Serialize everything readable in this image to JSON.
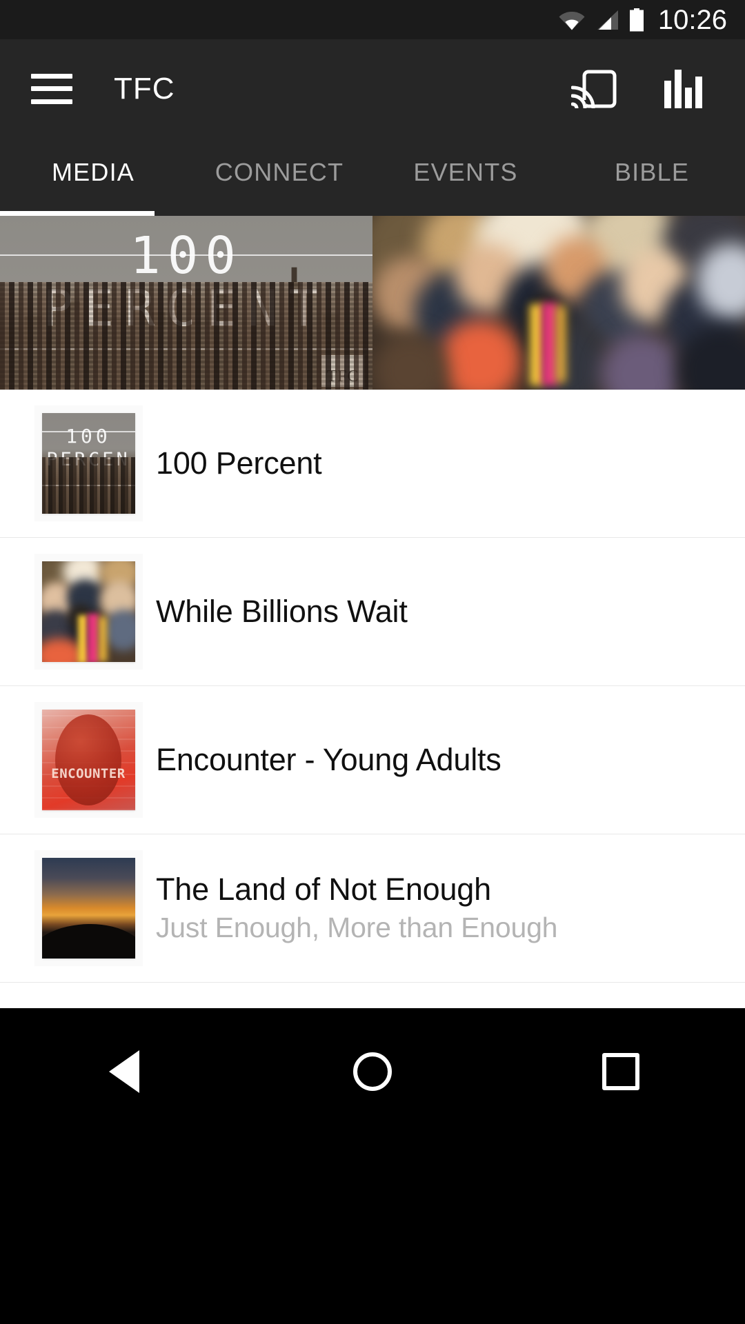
{
  "status_bar": {
    "time": "10:26",
    "icons": [
      "wifi-icon",
      "cellular-signal-icon",
      "battery-icon"
    ]
  },
  "app_bar": {
    "menu_icon": "hamburger-menu-icon",
    "title": "TFC",
    "cast_icon": "cast-icon",
    "equalizer_icon": "equalizer-icon"
  },
  "tabs": {
    "active_index": 0,
    "items": [
      {
        "label": "MEDIA"
      },
      {
        "label": "CONNECT"
      },
      {
        "label": "EVENTS"
      },
      {
        "label": "BIBLE"
      }
    ]
  },
  "hero_carousel": {
    "slides": [
      {
        "title_line1": "100",
        "title_line2": "PERCENT",
        "logo": "TFC"
      },
      {
        "title_line1": "",
        "title_line2": "",
        "logo": ""
      }
    ]
  },
  "media_list": {
    "items": [
      {
        "title": "100 Percent",
        "subtitle": "",
        "thumb": "city-skyline-thumbnail",
        "thumb_text_1": "100",
        "thumb_text_2": "PERCEN"
      },
      {
        "title": "While Billions Wait",
        "subtitle": "",
        "thumb": "crowd-photo-thumbnail",
        "thumb_text_1": "",
        "thumb_text_2": ""
      },
      {
        "title": "Encounter - Young Adults",
        "subtitle": "",
        "thumb": "encounter-logo-thumbnail",
        "thumb_text_1": "",
        "thumb_text_2": "ENCOUNTER"
      },
      {
        "title": "The Land of Not Enough",
        "subtitle": "Just Enough, More than Enough",
        "thumb": "sunset-photo-thumbnail",
        "thumb_text_1": "",
        "thumb_text_2": ""
      }
    ]
  },
  "nav_bar": {
    "back_label": "back-button",
    "home_label": "home-button",
    "recents_label": "recents-button"
  },
  "colors": {
    "status_bar_bg": "#1b1b1b",
    "app_bar_bg": "#262626",
    "tab_active": "#ffffff",
    "tab_inactive": "#9c9c9c",
    "list_bg": "#ffffff",
    "title_text": "#101010",
    "subtitle_text": "#b4b4b4",
    "nav_bar_bg": "#000000"
  }
}
